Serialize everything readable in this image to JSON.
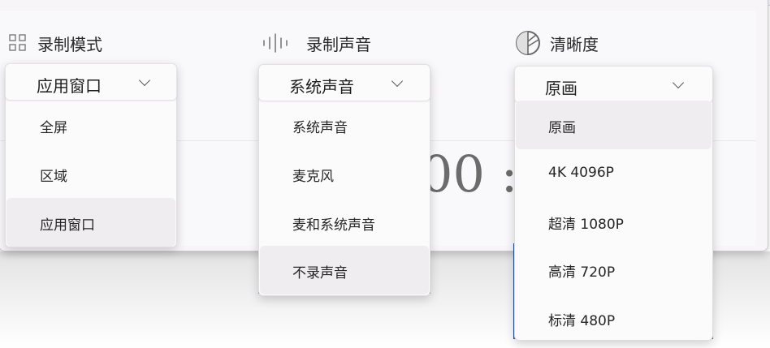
{
  "header": {
    "mode_label": "录制模式",
    "audio_label": "录制声音",
    "quality_label": "清晰度"
  },
  "timer_text": "00 : 0",
  "icons": {
    "mode": "grid-icon",
    "audio": "waveform-icon",
    "quality": "quality-dial-icon",
    "dropdown": "chevron-down-icon"
  },
  "mode_dropdown": {
    "selected": "应用窗口",
    "options": [
      "全屏",
      "区域",
      "应用窗口"
    ],
    "highlighted_index": 2
  },
  "audio_dropdown": {
    "selected": "系统声音",
    "options": [
      "系统声音",
      "麦克风",
      "麦和系统声音",
      "不录声音"
    ],
    "highlighted_index": 3
  },
  "quality_dropdown": {
    "selected": "原画",
    "options": [
      "原画",
      "4K 4096P",
      "超清 1080P",
      "高清 720P",
      "标清 480P"
    ],
    "highlighted_index": 0
  },
  "colors": {
    "accent_blue": "#2a4ea3",
    "panel": "#f9f8fa",
    "highlight": "#efedf0"
  }
}
